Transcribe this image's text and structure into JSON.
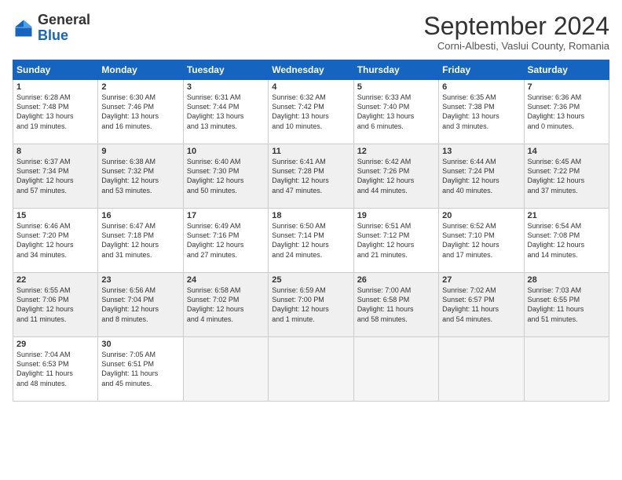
{
  "header": {
    "logo_general": "General",
    "logo_blue": "Blue",
    "month_title": "September 2024",
    "location": "Corni-Albesti, Vaslui County, Romania"
  },
  "weekdays": [
    "Sunday",
    "Monday",
    "Tuesday",
    "Wednesday",
    "Thursday",
    "Friday",
    "Saturday"
  ],
  "weeks": [
    [
      {
        "day": "1",
        "lines": [
          "Sunrise: 6:28 AM",
          "Sunset: 7:48 PM",
          "Daylight: 13 hours",
          "and 19 minutes."
        ]
      },
      {
        "day": "2",
        "lines": [
          "Sunrise: 6:30 AM",
          "Sunset: 7:46 PM",
          "Daylight: 13 hours",
          "and 16 minutes."
        ]
      },
      {
        "day": "3",
        "lines": [
          "Sunrise: 6:31 AM",
          "Sunset: 7:44 PM",
          "Daylight: 13 hours",
          "and 13 minutes."
        ]
      },
      {
        "day": "4",
        "lines": [
          "Sunrise: 6:32 AM",
          "Sunset: 7:42 PM",
          "Daylight: 13 hours",
          "and 10 minutes."
        ]
      },
      {
        "day": "5",
        "lines": [
          "Sunrise: 6:33 AM",
          "Sunset: 7:40 PM",
          "Daylight: 13 hours",
          "and 6 minutes."
        ]
      },
      {
        "day": "6",
        "lines": [
          "Sunrise: 6:35 AM",
          "Sunset: 7:38 PM",
          "Daylight: 13 hours",
          "and 3 minutes."
        ]
      },
      {
        "day": "7",
        "lines": [
          "Sunrise: 6:36 AM",
          "Sunset: 7:36 PM",
          "Daylight: 13 hours",
          "and 0 minutes."
        ]
      }
    ],
    [
      {
        "day": "8",
        "lines": [
          "Sunrise: 6:37 AM",
          "Sunset: 7:34 PM",
          "Daylight: 12 hours",
          "and 57 minutes."
        ]
      },
      {
        "day": "9",
        "lines": [
          "Sunrise: 6:38 AM",
          "Sunset: 7:32 PM",
          "Daylight: 12 hours",
          "and 53 minutes."
        ]
      },
      {
        "day": "10",
        "lines": [
          "Sunrise: 6:40 AM",
          "Sunset: 7:30 PM",
          "Daylight: 12 hours",
          "and 50 minutes."
        ]
      },
      {
        "day": "11",
        "lines": [
          "Sunrise: 6:41 AM",
          "Sunset: 7:28 PM",
          "Daylight: 12 hours",
          "and 47 minutes."
        ]
      },
      {
        "day": "12",
        "lines": [
          "Sunrise: 6:42 AM",
          "Sunset: 7:26 PM",
          "Daylight: 12 hours",
          "and 44 minutes."
        ]
      },
      {
        "day": "13",
        "lines": [
          "Sunrise: 6:44 AM",
          "Sunset: 7:24 PM",
          "Daylight: 12 hours",
          "and 40 minutes."
        ]
      },
      {
        "day": "14",
        "lines": [
          "Sunrise: 6:45 AM",
          "Sunset: 7:22 PM",
          "Daylight: 12 hours",
          "and 37 minutes."
        ]
      }
    ],
    [
      {
        "day": "15",
        "lines": [
          "Sunrise: 6:46 AM",
          "Sunset: 7:20 PM",
          "Daylight: 12 hours",
          "and 34 minutes."
        ]
      },
      {
        "day": "16",
        "lines": [
          "Sunrise: 6:47 AM",
          "Sunset: 7:18 PM",
          "Daylight: 12 hours",
          "and 31 minutes."
        ]
      },
      {
        "day": "17",
        "lines": [
          "Sunrise: 6:49 AM",
          "Sunset: 7:16 PM",
          "Daylight: 12 hours",
          "and 27 minutes."
        ]
      },
      {
        "day": "18",
        "lines": [
          "Sunrise: 6:50 AM",
          "Sunset: 7:14 PM",
          "Daylight: 12 hours",
          "and 24 minutes."
        ]
      },
      {
        "day": "19",
        "lines": [
          "Sunrise: 6:51 AM",
          "Sunset: 7:12 PM",
          "Daylight: 12 hours",
          "and 21 minutes."
        ]
      },
      {
        "day": "20",
        "lines": [
          "Sunrise: 6:52 AM",
          "Sunset: 7:10 PM",
          "Daylight: 12 hours",
          "and 17 minutes."
        ]
      },
      {
        "day": "21",
        "lines": [
          "Sunrise: 6:54 AM",
          "Sunset: 7:08 PM",
          "Daylight: 12 hours",
          "and 14 minutes."
        ]
      }
    ],
    [
      {
        "day": "22",
        "lines": [
          "Sunrise: 6:55 AM",
          "Sunset: 7:06 PM",
          "Daylight: 12 hours",
          "and 11 minutes."
        ]
      },
      {
        "day": "23",
        "lines": [
          "Sunrise: 6:56 AM",
          "Sunset: 7:04 PM",
          "Daylight: 12 hours",
          "and 8 minutes."
        ]
      },
      {
        "day": "24",
        "lines": [
          "Sunrise: 6:58 AM",
          "Sunset: 7:02 PM",
          "Daylight: 12 hours",
          "and 4 minutes."
        ]
      },
      {
        "day": "25",
        "lines": [
          "Sunrise: 6:59 AM",
          "Sunset: 7:00 PM",
          "Daylight: 12 hours",
          "and 1 minute."
        ]
      },
      {
        "day": "26",
        "lines": [
          "Sunrise: 7:00 AM",
          "Sunset: 6:58 PM",
          "Daylight: 11 hours",
          "and 58 minutes."
        ]
      },
      {
        "day": "27",
        "lines": [
          "Sunrise: 7:02 AM",
          "Sunset: 6:57 PM",
          "Daylight: 11 hours",
          "and 54 minutes."
        ]
      },
      {
        "day": "28",
        "lines": [
          "Sunrise: 7:03 AM",
          "Sunset: 6:55 PM",
          "Daylight: 11 hours",
          "and 51 minutes."
        ]
      }
    ],
    [
      {
        "day": "29",
        "lines": [
          "Sunrise: 7:04 AM",
          "Sunset: 6:53 PM",
          "Daylight: 11 hours",
          "and 48 minutes."
        ]
      },
      {
        "day": "30",
        "lines": [
          "Sunrise: 7:05 AM",
          "Sunset: 6:51 PM",
          "Daylight: 11 hours",
          "and 45 minutes."
        ]
      },
      {
        "day": "",
        "lines": []
      },
      {
        "day": "",
        "lines": []
      },
      {
        "day": "",
        "lines": []
      },
      {
        "day": "",
        "lines": []
      },
      {
        "day": "",
        "lines": []
      }
    ]
  ]
}
